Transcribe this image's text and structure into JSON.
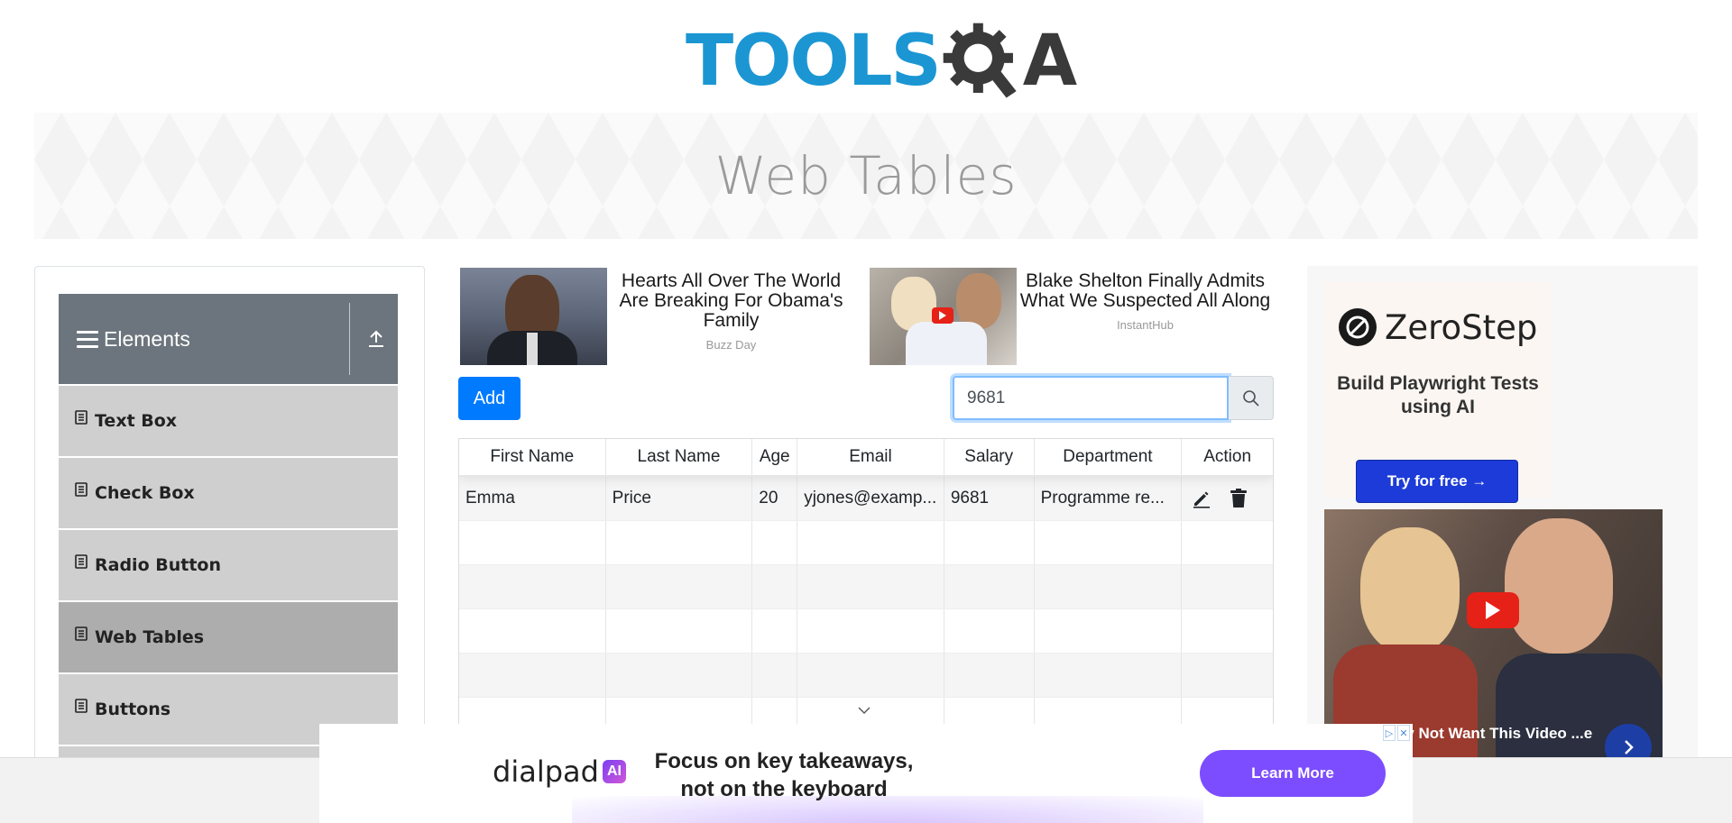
{
  "logo": {
    "tools": "TOOLS",
    "qa": "A"
  },
  "banner": {
    "title": "Web Tables"
  },
  "sidebar": {
    "group_title": "Elements",
    "items": [
      {
        "label": "Text Box"
      },
      {
        "label": "Check Box"
      },
      {
        "label": "Radio Button"
      },
      {
        "label": "Web Tables",
        "active": true
      },
      {
        "label": "Buttons"
      }
    ]
  },
  "ads": [
    {
      "title": "Hearts All Over The World Are Breaking For Obama's Family",
      "source": "Buzz Day"
    },
    {
      "title": "Blake Shelton Finally Admits What We Suspected All Along",
      "source": "InstantHub"
    }
  ],
  "controls": {
    "add_label": "Add",
    "search_value": "9681"
  },
  "table": {
    "columns": [
      "First Name",
      "Last Name",
      "Age",
      "Email",
      "Salary",
      "Department",
      "Action"
    ],
    "rows": [
      {
        "first": "Emma",
        "last": "Price",
        "age": "20",
        "email": "yjones@examp...",
        "salary": "9681",
        "department": "Programme re..."
      }
    ]
  },
  "right_ad": {
    "brand": "ZeroStep",
    "tagline": "Build Playwright Tests using AI",
    "cta": "Try for free →",
    "video_caption": "Hillary May Not Want This Video ...e Rounds"
  },
  "bottom_ad": {
    "brand": "dialpad",
    "badge": "AI",
    "headline": "Focus on key takeaways, not on the keyboard",
    "cta": "Learn More",
    "adchoice_i": "▷",
    "adchoice_x": "✕"
  },
  "colors": {
    "primary": "#007bff",
    "logo_blue": "#1b96d3",
    "sidebar_header": "#6c757d",
    "zerostep_button": "#1c3bd8",
    "dialpad_purple": "#7c4dff"
  }
}
